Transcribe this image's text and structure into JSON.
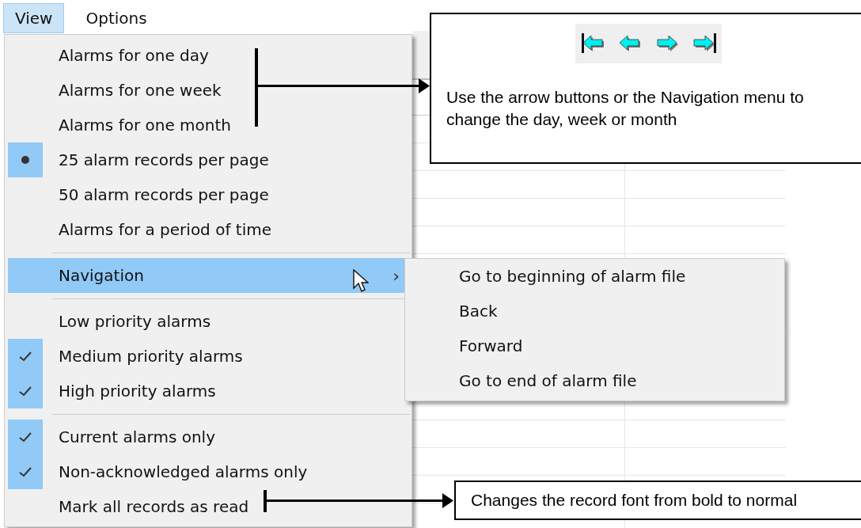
{
  "menubar": [
    {
      "label": "View",
      "selected": true
    },
    {
      "label": "Options",
      "selected": false
    }
  ],
  "view_menu": [
    {
      "kind": "radio",
      "label": "Alarms for one day",
      "checked": false
    },
    {
      "kind": "radio",
      "label": "Alarms for one week",
      "checked": false
    },
    {
      "kind": "radio",
      "label": "Alarms for one month",
      "checked": false
    },
    {
      "kind": "radio",
      "label": "25 alarm records per page",
      "checked": true
    },
    {
      "kind": "radio",
      "label": "50 alarm records per page",
      "checked": false
    },
    {
      "kind": "radio",
      "label": "Alarms for a period of time",
      "checked": false
    },
    {
      "kind": "separator"
    },
    {
      "kind": "submenu",
      "label": "Navigation",
      "selected": true,
      "arrow": "›"
    },
    {
      "kind": "separator"
    },
    {
      "kind": "check",
      "label": "Low priority alarms",
      "checked": false
    },
    {
      "kind": "check",
      "label": "Medium priority alarms",
      "checked": true
    },
    {
      "kind": "check",
      "label": "High priority alarms",
      "checked": true
    },
    {
      "kind": "separator"
    },
    {
      "kind": "check",
      "label": "Current alarms only",
      "checked": true
    },
    {
      "kind": "check",
      "label": "Non-acknowledged alarms only",
      "checked": true
    },
    {
      "kind": "command",
      "label": "Mark all records as read"
    }
  ],
  "navigation_submenu": [
    "Go to beginning of alarm file",
    "Back",
    "Forward",
    "Go to end of alarm file"
  ],
  "annotations": [
    {
      "kind": "toolbar",
      "text": "Use the arrow buttons or the Navigation menu to change the day, week or month"
    },
    {
      "kind": "plain",
      "text": "Changes the record font from bold to normal"
    }
  ]
}
